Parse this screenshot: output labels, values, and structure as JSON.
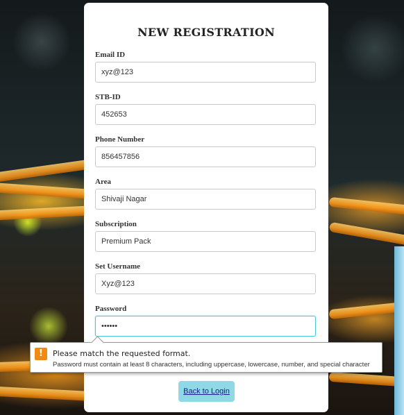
{
  "form": {
    "title": "NEW REGISTRATION",
    "fields": [
      {
        "label": "Email ID",
        "value": "xyz@123"
      },
      {
        "label": "STB-ID",
        "value": "452653"
      },
      {
        "label": "Phone Number",
        "value": "856457856"
      },
      {
        "label": "Area",
        "value": "Shivaji Nagar"
      },
      {
        "label": "Subscription",
        "value": "Premium Pack"
      },
      {
        "label": "Set Username",
        "value": "Xyz@123"
      },
      {
        "label": "Password",
        "value": "••••••"
      }
    ],
    "back_link": "Back to Login"
  },
  "validation_tooltip": {
    "icon": "warning-icon",
    "icon_glyph": "!",
    "title": "Please match the requested format.",
    "detail": "Password must contain at least 8 characters, including uppercase, lowercase, number, and special character"
  },
  "colors": {
    "accent": "#4fc3d8",
    "button_bg": "#8fd9e6",
    "warning": "#f08a12"
  }
}
